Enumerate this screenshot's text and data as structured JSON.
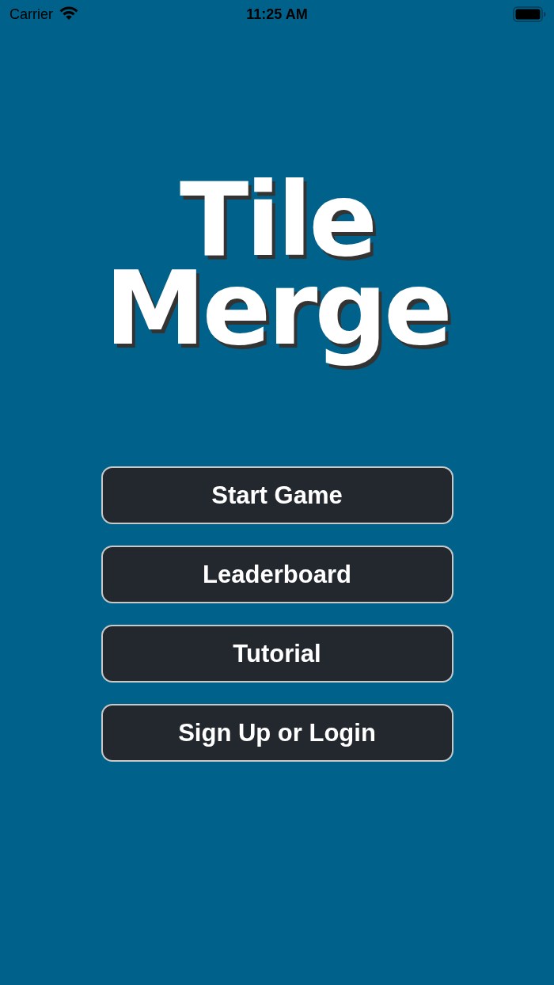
{
  "status_bar": {
    "carrier": "Carrier",
    "time": "11:25 AM"
  },
  "title": "Tile Merge",
  "buttons": [
    {
      "label": "Start Game"
    },
    {
      "label": "Leaderboard"
    },
    {
      "label": "Tutorial"
    },
    {
      "label": "Sign Up or Login"
    }
  ]
}
